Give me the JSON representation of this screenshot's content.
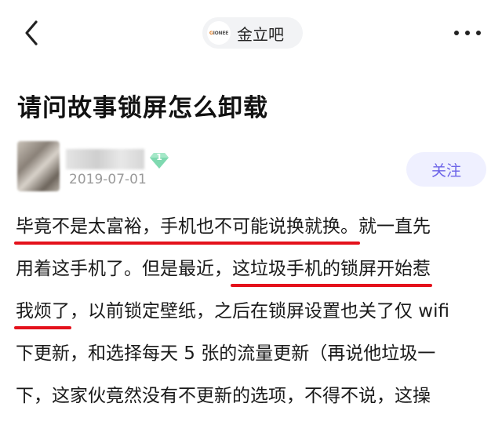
{
  "header": {
    "forum_name": "金立吧",
    "forum_logo_text_g": "G",
    "forum_logo_text_rest": "IONEE"
  },
  "post": {
    "title": "请问故事锁屏怎么卸载",
    "author_level": "1",
    "date": "2019-07-01",
    "follow_label": "关注",
    "content": {
      "line1_hl": "毕竟不是太富裕，手机也不可能说换就换。",
      "line1_rest": "就一直先",
      "line2_pre": "用着这手机了。但是最近，",
      "line2_hl": "这垃圾手机的锁屏开始惹",
      "line3_hl": "我烦了",
      "line3_rest": "，以前锁定壁纸，之后在锁屏设置也关了仅 wifi",
      "line4": "下更新，和选择每天 5 张的流量更新（再说他垃圾一",
      "line5": "下，这家伙竟然没有不更新的选项，不得不说，这操"
    }
  },
  "colors": {
    "accent": "#6c63e8",
    "follow_bg": "#eff0ff",
    "underline": "#e4111b",
    "badge": "#7fd9b0"
  },
  "icons": {
    "back": "chevron-left-icon",
    "more": "more-dots-icon",
    "badge": "diamond-level-icon"
  }
}
